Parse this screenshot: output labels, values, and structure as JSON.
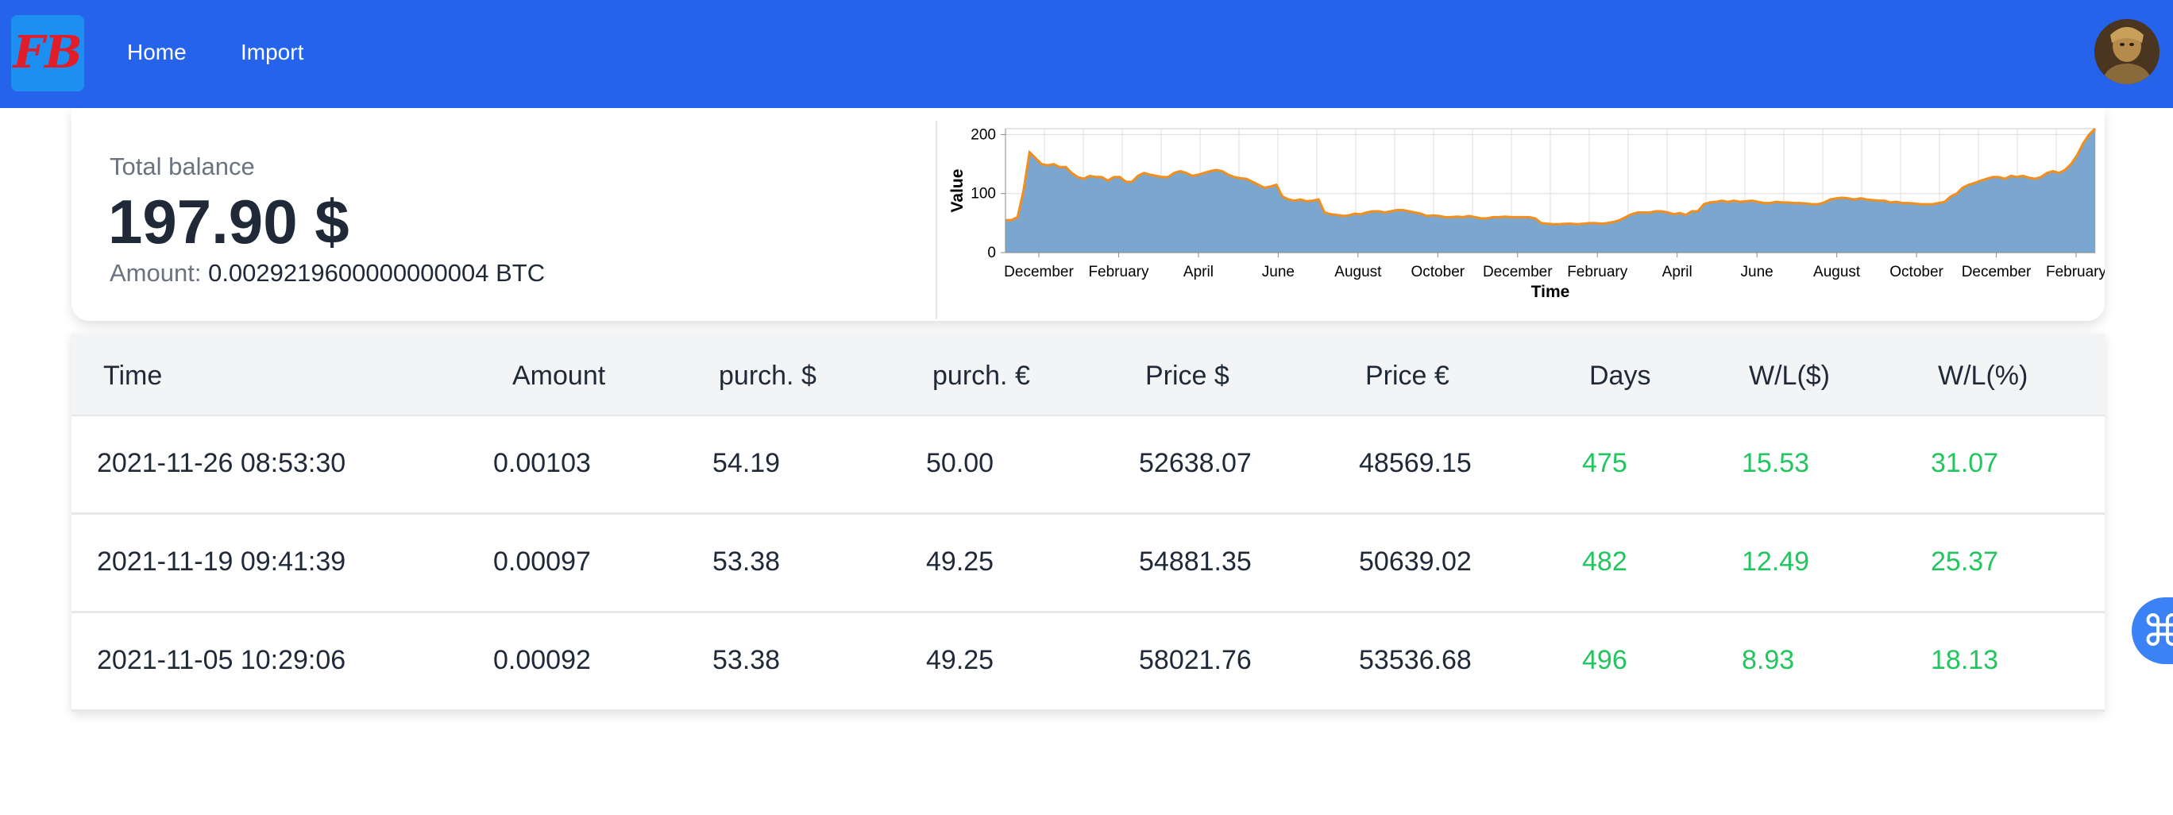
{
  "navbar": {
    "logo_text": "FB",
    "links": [
      {
        "label": "Home"
      },
      {
        "label": "Import"
      }
    ],
    "avatar_icon": "user-avatar-icon"
  },
  "summary": {
    "total_label": "Total balance",
    "total_value": "197.90 $",
    "amount_label": "Amount:",
    "amount_value": "0.0029219600000000004 BTC"
  },
  "chart_data": {
    "type": "area",
    "xlabel": "Time",
    "ylabel": "Value",
    "ylim": [
      0,
      210
    ],
    "yticks": [
      0,
      100,
      200
    ],
    "month_ticks": [
      "December",
      "February",
      "April",
      "June",
      "August",
      "October",
      "December",
      "February",
      "April",
      "June",
      "August",
      "October",
      "December",
      "February"
    ],
    "grid": true,
    "fill_color": "#7aa6cf",
    "line_color": "#f28e1c",
    "series": [
      {
        "values": [
          55,
          55,
          60,
          105,
          170,
          160,
          150,
          148,
          150,
          145,
          145,
          135,
          128,
          125,
          130,
          128,
          128,
          122,
          128,
          128,
          120,
          120,
          130,
          135,
          132,
          130,
          128,
          128,
          135,
          138,
          135,
          130,
          132,
          135,
          138,
          140,
          138,
          132,
          128,
          126,
          125,
          120,
          115,
          110,
          112,
          115,
          95,
          90,
          88,
          90,
          87,
          88,
          90,
          68,
          65,
          64,
          62,
          63,
          66,
          65,
          68,
          70,
          70,
          68,
          70,
          72,
          72,
          70,
          68,
          66,
          62,
          63,
          62,
          60,
          60,
          61,
          60,
          62,
          60,
          58,
          58,
          60,
          60,
          61,
          60,
          60,
          60,
          60,
          58,
          50,
          49,
          48,
          48,
          49,
          49,
          48,
          49,
          50,
          50,
          49,
          50,
          52,
          55,
          60,
          65,
          68,
          68,
          68,
          70,
          70,
          68,
          65,
          67,
          64,
          70,
          70,
          82,
          85,
          86,
          88,
          86,
          88,
          86,
          87,
          88,
          86,
          84,
          84,
          86,
          85,
          85,
          84,
          84,
          83,
          82,
          82,
          85,
          90,
          92,
          93,
          92,
          90,
          92,
          90,
          89,
          88,
          88,
          85,
          86,
          84,
          84,
          83,
          82,
          82,
          82,
          84,
          86,
          95,
          100,
          110,
          115,
          118,
          122,
          125,
          128,
          128,
          125,
          130,
          128,
          130,
          127,
          125,
          128,
          135,
          138,
          135,
          140,
          150,
          165,
          185,
          200,
          210
        ]
      }
    ]
  },
  "table": {
    "headers": [
      "Time",
      "Amount",
      "purch. $",
      "purch. €",
      "Price $",
      "Price €",
      "Days",
      "W/L($)",
      "W/L(%)"
    ],
    "rows": [
      [
        "2021-11-26 08:53:30",
        "0.00103",
        "54.19",
        "50.00",
        "52638.07",
        "48569.15",
        "475",
        "15.53",
        "31.07"
      ],
      [
        "2021-11-19 09:41:39",
        "0.00097",
        "53.38",
        "49.25",
        "54881.35",
        "50639.02",
        "482",
        "12.49",
        "25.37"
      ],
      [
        "2021-11-05 10:29:06",
        "0.00092",
        "53.38",
        "49.25",
        "58021.76",
        "53536.68",
        "496",
        "8.93",
        "18.13"
      ]
    ]
  },
  "float_button": {
    "icon": "command-icon",
    "glyph": "⌘"
  },
  "colors": {
    "navbar": "#2563eb",
    "positive": "#22c55e"
  }
}
